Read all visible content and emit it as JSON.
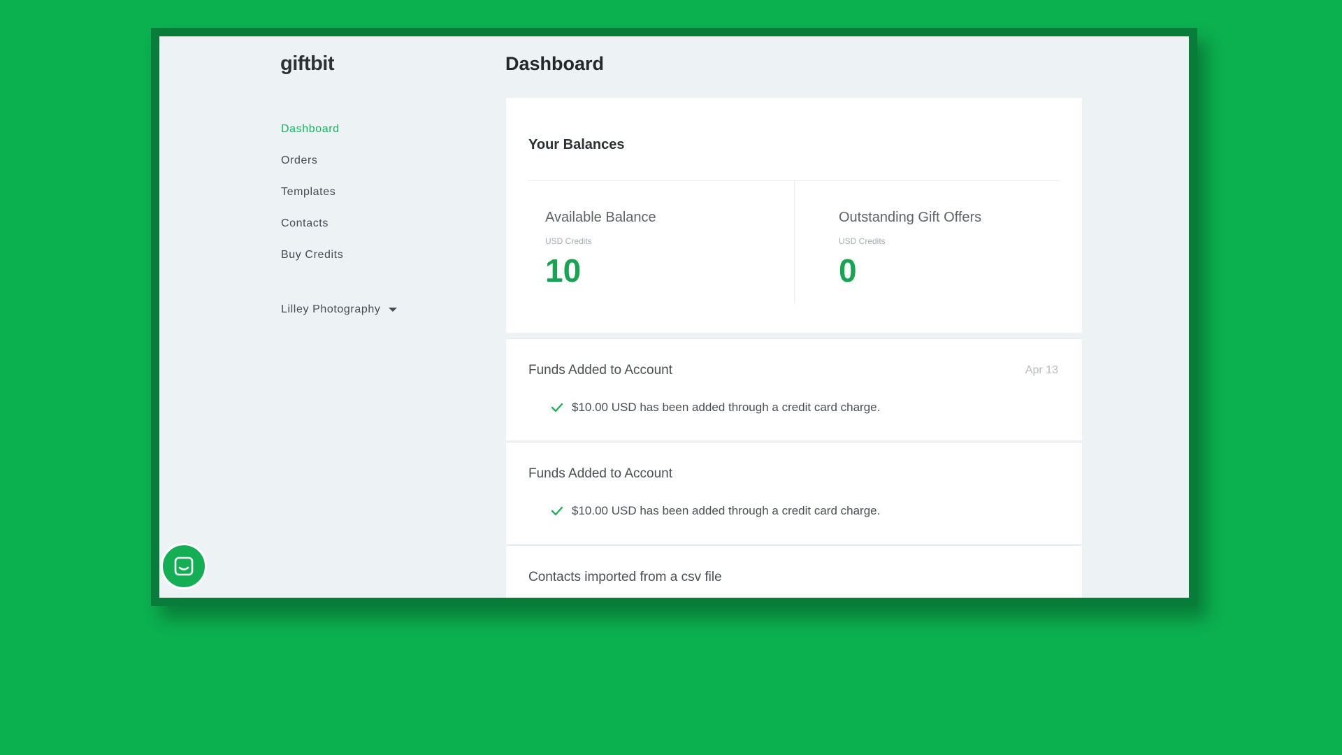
{
  "sidebar": {
    "logo": "giftbit",
    "nav": [
      {
        "label": "Dashboard",
        "active": true
      },
      {
        "label": "Orders",
        "active": false
      },
      {
        "label": "Templates",
        "active": false
      },
      {
        "label": "Contacts",
        "active": false
      },
      {
        "label": "Buy Credits",
        "active": false
      }
    ],
    "account": "Lilley Photography"
  },
  "main": {
    "title": "Dashboard",
    "balances": {
      "title": "Your Balances",
      "available": {
        "label": "Available Balance",
        "unit": "USD Credits",
        "value": "10"
      },
      "outstanding": {
        "label": "Outstanding Gift Offers",
        "unit": "USD Credits",
        "value": "0"
      }
    },
    "activity": [
      {
        "title": "Funds Added to Account",
        "date": "Apr 13",
        "detail": "$10.00 USD has been added through a credit card charge."
      },
      {
        "title": "Funds Added to Account",
        "date": "",
        "detail": "$10.00 USD has been added through a credit card charge."
      },
      {
        "title": "Contacts imported from a csv file",
        "date": "",
        "detail": ""
      }
    ]
  },
  "colors": {
    "background": "#0bb04f",
    "accent": "#16a653",
    "frame": "#087d39"
  },
  "icons": {
    "chat": "chat-bubble-icon",
    "check": "check-icon",
    "caret": "caret-down-icon"
  }
}
